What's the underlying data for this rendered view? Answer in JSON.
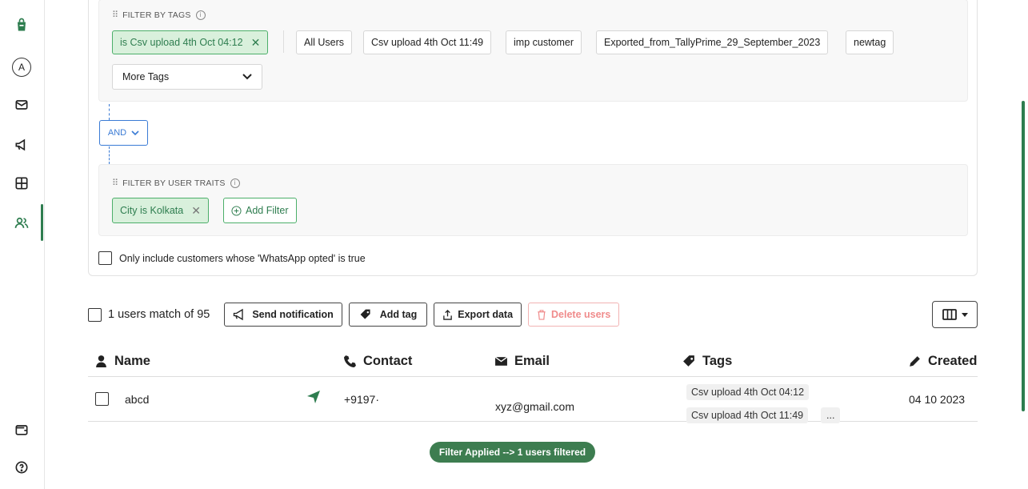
{
  "filters": {
    "tags_title": "FILTER BY TAGS",
    "applied_tag": "is Csv upload 4th Oct 04:12",
    "tag_options": [
      "All Users",
      "Csv upload 4th Oct 11:49",
      "imp customer",
      "Exported_from_TallyPrime_29_September_2023",
      "newtag"
    ],
    "more_tags": "More Tags",
    "operator": "AND",
    "traits_title": "FILTER BY USER TRAITS",
    "applied_trait": "City is Kolkata",
    "add_filter": "Add Filter",
    "whatsapp_opt": "Only include customers whose 'WhatsApp opted' is true"
  },
  "toolbar": {
    "match_text": "1 users match of 95",
    "send_notification": "Send notification",
    "add_tag": "Add tag",
    "export_data": "Export data",
    "delete_users": "Delete users"
  },
  "table": {
    "headers": {
      "name": "Name",
      "contact": "Contact",
      "email": "Email",
      "tags": "Tags",
      "created": "Created"
    },
    "rows": [
      {
        "name": "abcd",
        "contact": "+9197·",
        "email": "xyz@gmail.com",
        "tags": [
          "Csv upload 4th Oct 04:12",
          "Csv upload 4th Oct 11:49"
        ],
        "more": "...",
        "created": "04 10 2023"
      }
    ]
  },
  "toast": "Filter Applied --> 1 users filtered",
  "rail": {
    "avatar_letter": "A"
  },
  "colors": {
    "brand": "#2e7d4f",
    "chip_bg": "#d9f0dc",
    "operator": "#3a7bd5",
    "danger": "#f08c8c"
  }
}
